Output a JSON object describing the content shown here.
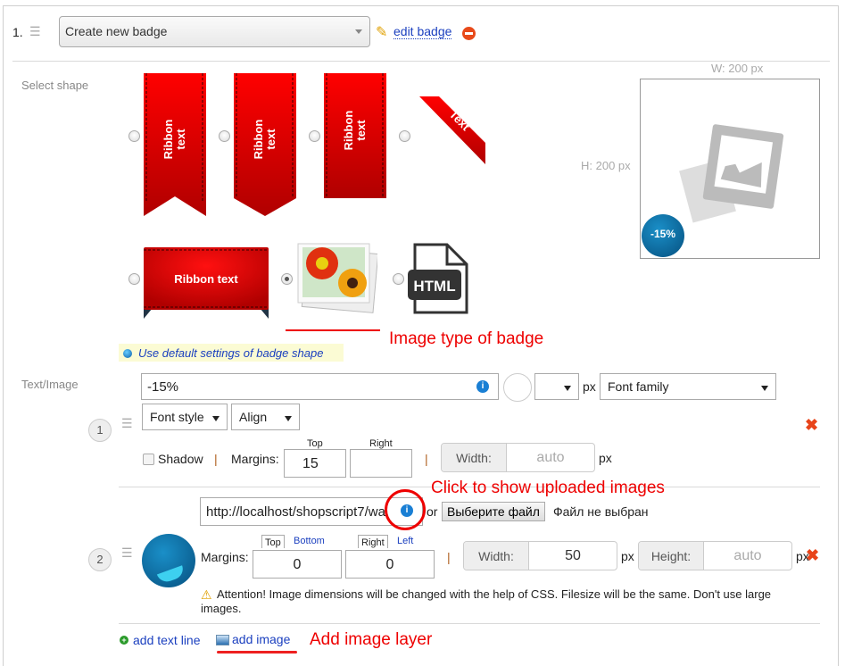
{
  "header": {
    "index": "1.",
    "badge_select": "Create new badge",
    "edit_badge_link": "edit badge"
  },
  "shape_section": {
    "label": "Select shape",
    "shapes": [
      {
        "name": "ribbon-swallowtail",
        "text": "Ribbon text",
        "selected": false
      },
      {
        "name": "ribbon-pointed",
        "text": "Ribbon text",
        "selected": false
      },
      {
        "name": "ribbon-flat",
        "text": "Ribbon text",
        "selected": false
      },
      {
        "name": "corner-ribbon",
        "text": "Text",
        "selected": false
      },
      {
        "name": "horizontal-ribbon",
        "text": "Ribbon text",
        "selected": false
      },
      {
        "name": "image",
        "text": "",
        "selected": true
      },
      {
        "name": "html",
        "text": "HTML",
        "selected": false
      }
    ],
    "default_settings_link": "Use default settings of badge shape"
  },
  "preview": {
    "width_label": "W: 200 px",
    "height_label": "H: 200 px",
    "badge_text": "-15%"
  },
  "annotations": {
    "image_type": "Image type of badge",
    "show_uploaded": "Click to show uploaded images",
    "add_image_layer": "Add image layer"
  },
  "text_image_section": {
    "label": "Text/Image",
    "layer1": {
      "number": "1",
      "text_value": "-15%",
      "font_size_value": "",
      "px": "px",
      "font_family": "Font family",
      "font_style": "Font style",
      "align": "Align",
      "shadow_label": "Shadow",
      "separator": "|",
      "margins_label": "Margins:",
      "margin_top_label": "Top",
      "margin_top_value": "15",
      "margin_right_label": "Right",
      "margin_right_value": "",
      "width_label": "Width:",
      "width_value": "auto",
      "width_px": "px"
    },
    "layer2": {
      "number": "2",
      "url_value": "http://localhost/shopscript7/wa",
      "or_label": "or",
      "choose_file_button": "Выберите файл",
      "no_file": "Файл не выбран",
      "margins_label": "Margins:",
      "tab_top": "Top",
      "tab_bottom": "Bottom",
      "tab_right": "Right",
      "tab_left": "Left",
      "margin_v_value": "0",
      "margin_h_value": "0",
      "separator": "|",
      "width_label": "Width:",
      "width_value": "50",
      "width_px": "px",
      "height_label": "Height:",
      "height_value": "auto",
      "height_px": "px",
      "warning": "Attention! Image dimensions will be changed with the help of CSS. Filesize will be the same. Don't use large images."
    },
    "add_text_line": "add text line",
    "add_image": "add image"
  }
}
